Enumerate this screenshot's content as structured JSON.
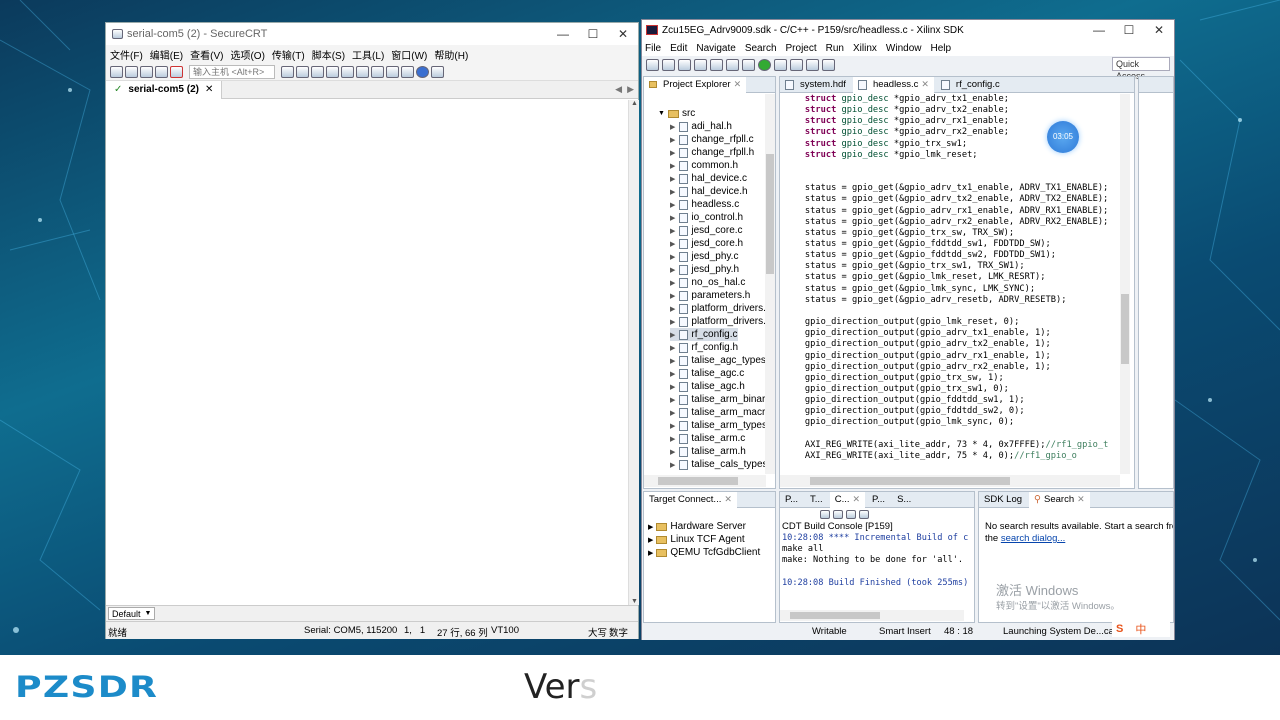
{
  "securecrt": {
    "title": "serial-com5 (2) - SecureCRT",
    "menu": [
      "文件(F)",
      "编辑(E)",
      "查看(V)",
      "选项(O)",
      "传输(T)",
      "脚本(S)",
      "工具(L)",
      "窗口(W)",
      "帮助(H)"
    ],
    "host_placeholder": "输入主机 <Alt+R>",
    "tab_label": "serial-com5 (2)",
    "session_select": "Default",
    "status": {
      "ready": "就绪",
      "connection": "Serial: COM5, 115200",
      "cursor": "1,   1",
      "size": "27 行, 66 列",
      "terminal": "VT100",
      "caps": "大写",
      "num": "数字"
    }
  },
  "sdk": {
    "title": "Zcu15EG_Adrv9009.sdk - C/C++ - P159/src/headless.c - Xilinx SDK",
    "menu": [
      "File",
      "Edit",
      "Navigate",
      "Search",
      "Project",
      "Run",
      "Xilinx",
      "Window",
      "Help"
    ],
    "quick_access": "Quick Access",
    "project_explorer": {
      "tab": "Project Explorer",
      "root": "src",
      "files": [
        "adi_hal.h",
        "change_rfpll.c",
        "change_rfpll.h",
        "common.h",
        "hal_device.c",
        "hal_device.h",
        "headless.c",
        "io_control.h",
        "jesd_core.c",
        "jesd_core.h",
        "jesd_phy.c",
        "jesd_phy.h",
        "no_os_hal.c",
        "parameters.h",
        "platform_drivers.c",
        "platform_drivers.h",
        "rf_config.c",
        "rf_config.h",
        "talise_agc_types.h",
        "talise_agc.c",
        "talise_agc.h",
        "talise_arm_binary.",
        "talise_arm_macros",
        "talise_arm_types.h",
        "talise_arm.c",
        "talise_arm.h",
        "talise_cals_types.h"
      ]
    },
    "editor_tabs": [
      "system.hdf",
      "headless.c",
      "rf_config.c"
    ],
    "code_lines": [
      "    struct gpio_desc *gpio_adrv_tx1_enable;",
      "    struct gpio_desc *gpio_adrv_tx2_enable;",
      "    struct gpio_desc *gpio_adrv_rx1_enable;",
      "    struct gpio_desc *gpio_adrv_rx2_enable;",
      "    struct gpio_desc *gpio_trx_sw1;",
      "    struct gpio_desc *gpio_lmk_reset;",
      "",
      "",
      "    status = gpio_get(&gpio_adrv_tx1_enable, ADRV_TX1_ENABLE);",
      "    status = gpio_get(&gpio_adrv_tx2_enable, ADRV_TX2_ENABLE);",
      "    status = gpio_get(&gpio_adrv_rx1_enable, ADRV_RX1_ENABLE);",
      "    status = gpio_get(&gpio_adrv_rx2_enable, ADRV_RX2_ENABLE);",
      "    status = gpio_get(&gpio_trx_sw, TRX_SW);",
      "    status = gpio_get(&gpio_fddtdd_sw1, FDDTDD_SW);",
      "    status = gpio_get(&gpio_fddtdd_sw2, FDDTDD_SW1);",
      "    status = gpio_get(&gpio_trx_sw1, TRX_SW1);",
      "    status = gpio_get(&gpio_lmk_reset, LMK_RESRT);",
      "    status = gpio_get(&gpio_lmk_sync, LMK_SYNC);",
      "    status = gpio_get(&gpio_adrv_resetb, ADRV_RESETB);",
      "",
      "    gpio_direction_output(gpio_lmk_reset, 0);",
      "    gpio_direction_output(gpio_adrv_tx1_enable, 1);",
      "    gpio_direction_output(gpio_adrv_tx2_enable, 1);",
      "    gpio_direction_output(gpio_adrv_rx1_enable, 1);",
      "    gpio_direction_output(gpio_adrv_rx2_enable, 1);",
      "    gpio_direction_output(gpio_trx_sw, 1);",
      "    gpio_direction_output(gpio_trx_sw1, 0);",
      "    gpio_direction_output(gpio_fddtdd_sw1, 1);",
      "    gpio_direction_output(gpio_fddtdd_sw2, 0);",
      "    gpio_direction_output(gpio_lmk_sync, 0);",
      "",
      "    AXI_REG_WRITE(axi_lite_addr, 73 * 4, 0x7FFFE);//rf1_gpio_t",
      "    AXI_REG_WRITE(axi_lite_addr, 75 * 4, 0);//rf1_gpio_o"
    ],
    "target_connections": {
      "tab": "Target Connect...",
      "items": [
        "Hardware Server",
        "Linux TCF Agent",
        "QEMU TcfGdbClient"
      ]
    },
    "console": {
      "tabs": [
        "P...",
        "T...",
        "C...",
        "P...",
        "S..."
      ],
      "title": "CDT Build Console [P159]",
      "lines": [
        "10:28:08 **** Incremental Build of c",
        "make all",
        "make: Nothing to be done for 'all'.",
        "",
        "10:28:08 Build Finished (took 255ms)"
      ]
    },
    "search": {
      "tabs": [
        "SDK Log",
        "Search"
      ],
      "message": "No search results available. Start a search from",
      "message2_prefix": "the ",
      "link": "search dialog..."
    },
    "status": {
      "writable": "Writable",
      "insert": "Smart Insert",
      "position": "48 : 18",
      "launch": "Launching System De...cal"
    }
  },
  "clock": "03:05",
  "windows_watermark": {
    "line1": "激活 Windows",
    "line2": "转到\"设置\"以激活 Windows。"
  },
  "logo": "PZSDR",
  "subtitle": {
    "main": "Ver",
    "faded": "s"
  }
}
